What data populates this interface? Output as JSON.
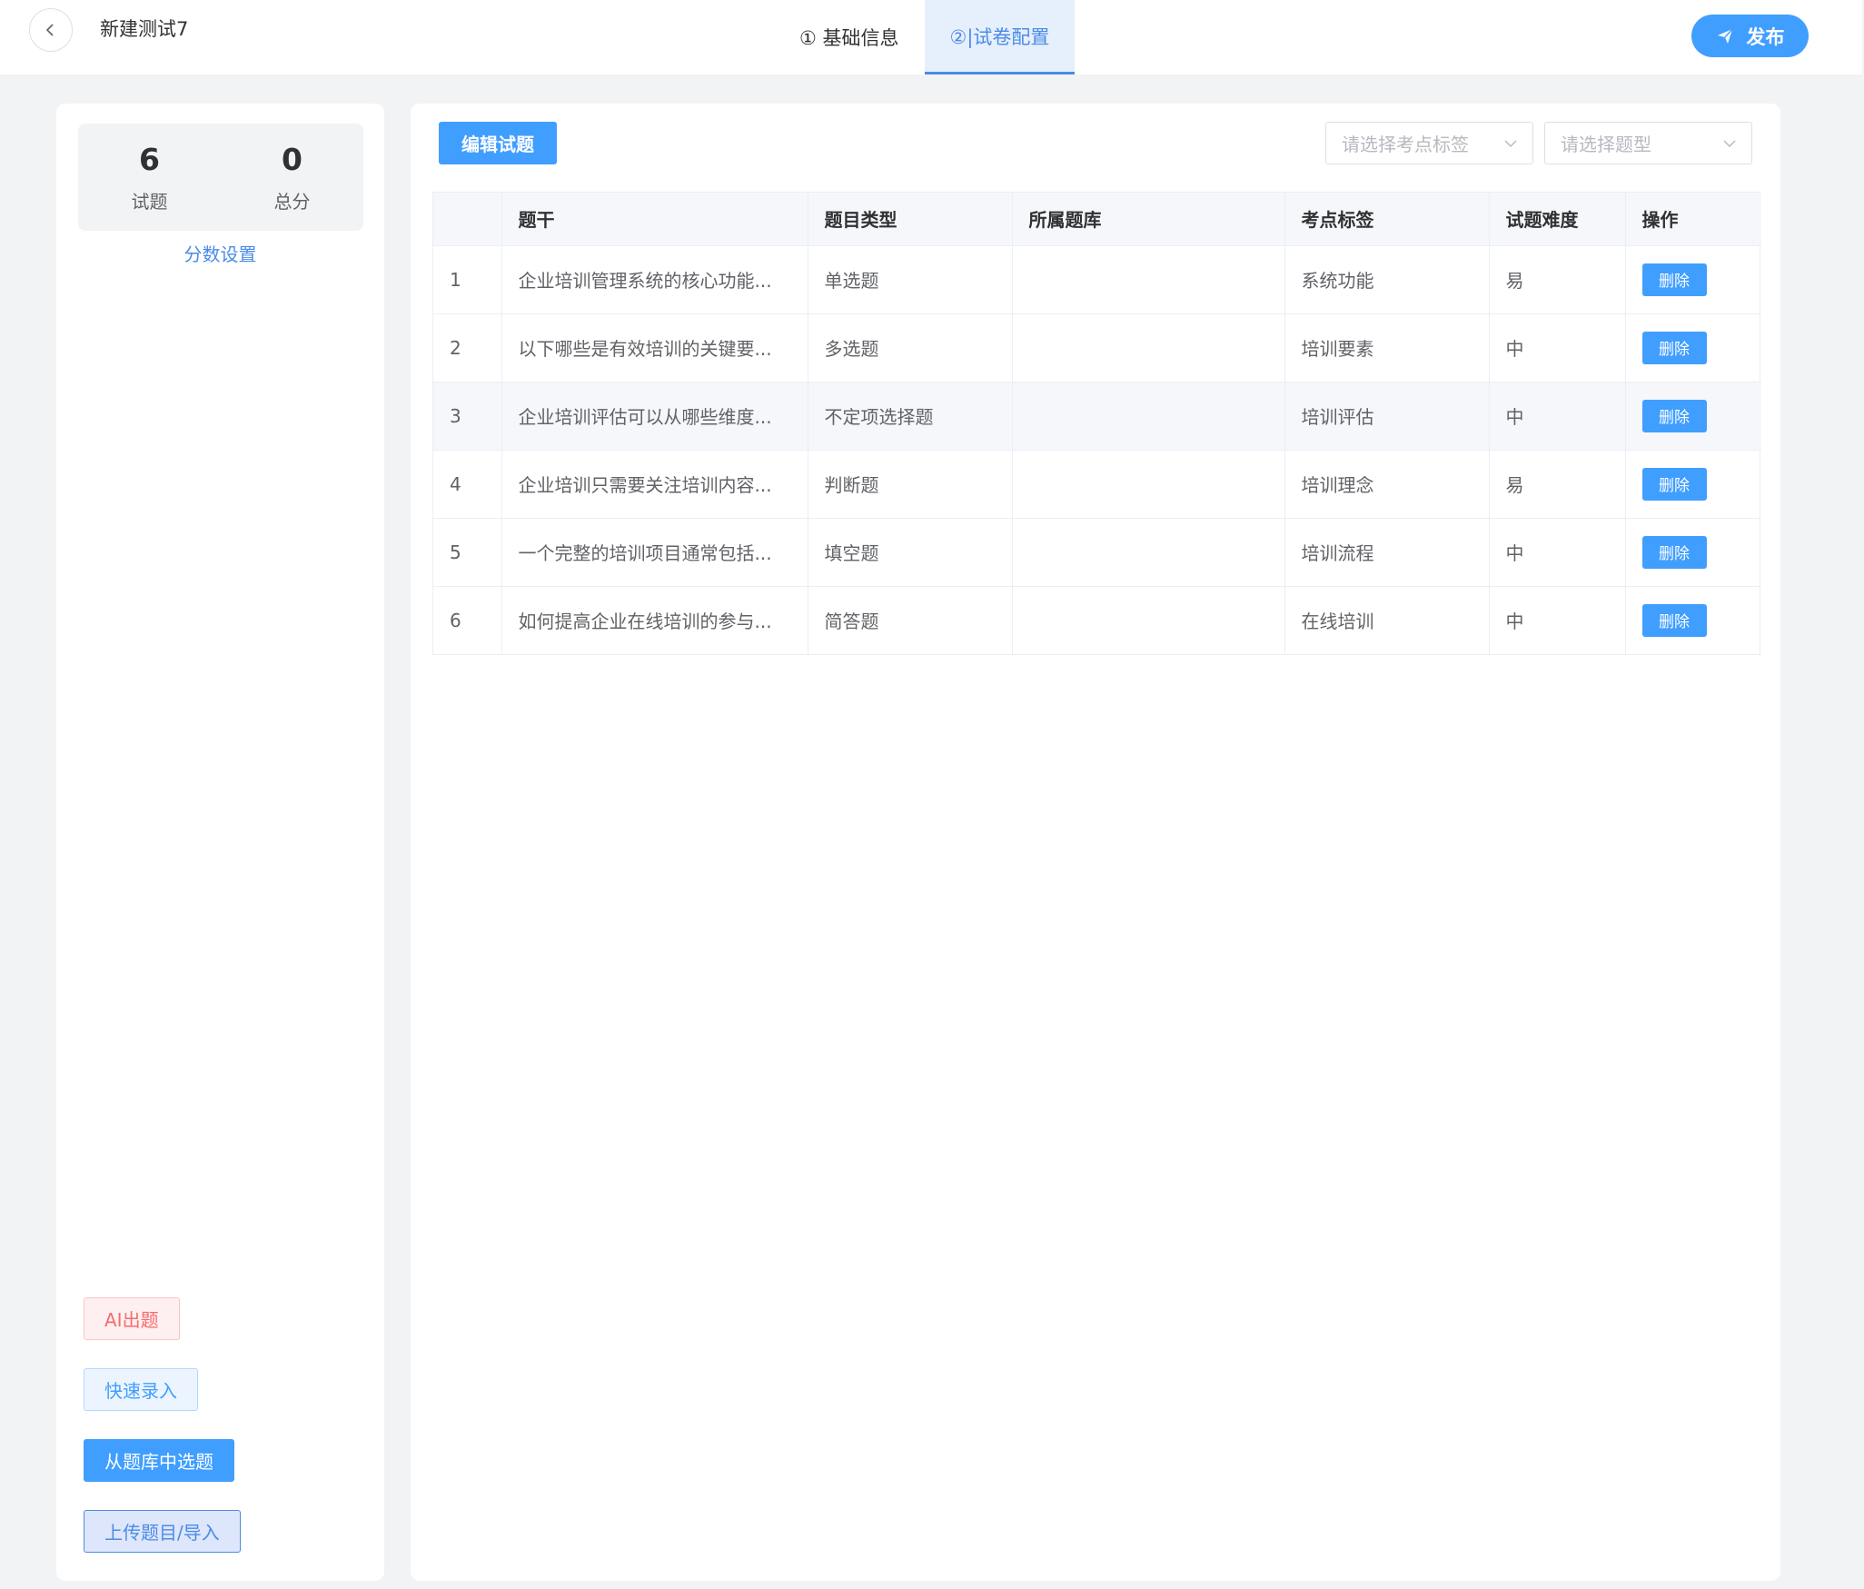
{
  "header": {
    "title": "新建测试7",
    "steps": [
      "① 基础信息",
      "②|试卷配置"
    ],
    "publish_label": "发布"
  },
  "stats": {
    "question_count": "6",
    "question_label": "试题",
    "total_score": "0",
    "total_label": "总分",
    "score_settings_link": "分数设置"
  },
  "side_buttons": {
    "ai": "AI出题",
    "quick": "快速录入",
    "from_bank": "从题库中选题",
    "upload": "上传题目/导入"
  },
  "toolbar": {
    "edit_label": "编辑试题",
    "tag_placeholder": "请选择考点标签",
    "type_placeholder": "请选择题型"
  },
  "table": {
    "headers": [
      "",
      "题干",
      "题目类型",
      "所属题库",
      "考点标签",
      "试题难度",
      "操作"
    ],
    "rows": [
      {
        "no": "1",
        "stem": "企业培训管理系统的核心功能...",
        "type": "单选题",
        "bank": "",
        "tag": "系统功能",
        "difficulty": "易",
        "action": "删除"
      },
      {
        "no": "2",
        "stem": "以下哪些是有效培训的关键要...",
        "type": "多选题",
        "bank": "",
        "tag": "培训要素",
        "difficulty": "中",
        "action": "删除"
      },
      {
        "no": "3",
        "stem": "企业培训评估可以从哪些维度...",
        "type": "不定项选择题",
        "bank": "",
        "tag": "培训评估",
        "difficulty": "中",
        "action": "删除"
      },
      {
        "no": "4",
        "stem": "企业培训只需要关注培训内容...",
        "type": "判断题",
        "bank": "",
        "tag": "培训理念",
        "difficulty": "易",
        "action": "删除"
      },
      {
        "no": "5",
        "stem": "一个完整的培训项目通常包括...",
        "type": "填空题",
        "bank": "",
        "tag": "培训流程",
        "difficulty": "中",
        "action": "删除"
      },
      {
        "no": "6",
        "stem": "如何提高企业在线培训的参与...",
        "type": "简答题",
        "bank": "",
        "tag": "在线培训",
        "difficulty": "中",
        "action": "删除"
      }
    ]
  },
  "colors": {
    "primary": "#409eff",
    "active_step": "#4b8be6",
    "danger": "#f56c6c"
  }
}
